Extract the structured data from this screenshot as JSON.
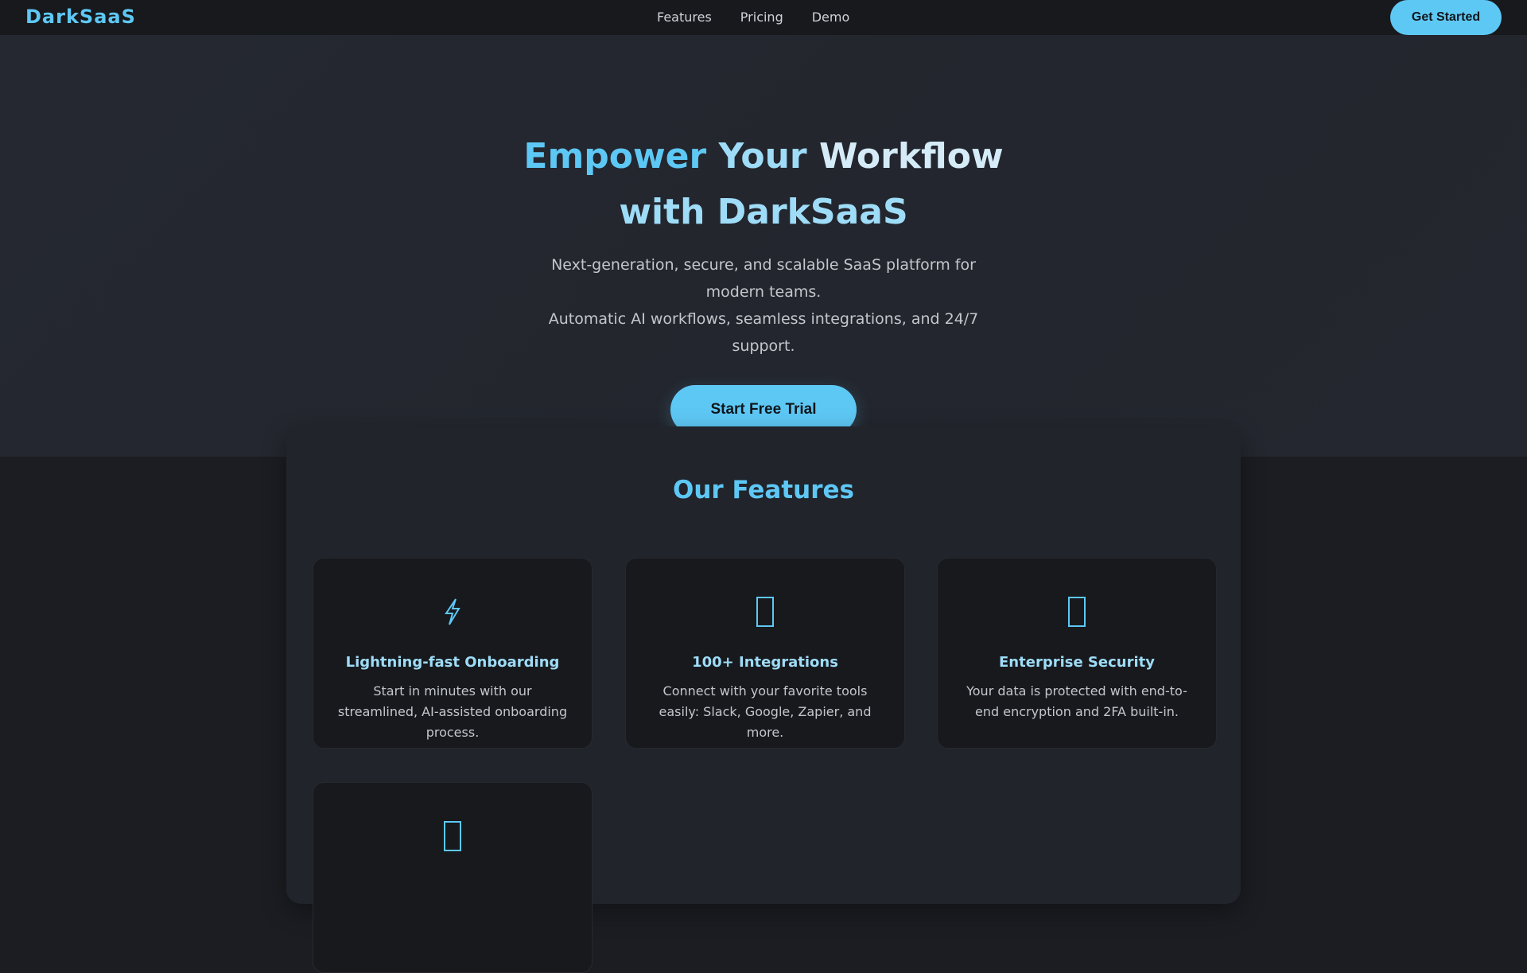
{
  "brand": {
    "logo": "DarkSaaS",
    "accent": "#5ec8f5"
  },
  "nav": {
    "items": [
      "Features",
      "Pricing",
      "Demo"
    ],
    "cta": "Get Started"
  },
  "hero": {
    "title_line1_word1": "Empower",
    "title_line1_word2": "Your",
    "title_line1_word3": "Workflow",
    "title_line2": "with DarkSaaS",
    "subtitle_line1": "Next-generation, secure, and scalable SaaS platform for modern teams.",
    "subtitle_line2": "Automatic AI workflows, seamless integrations, and 24/7 support.",
    "cta": "Start Free Trial"
  },
  "features": {
    "title": "Our Features",
    "cards": [
      {
        "icon": "lightning-icon",
        "title": "Lightning-fast Onboarding",
        "desc": "Start in minutes with our streamlined, AI-assisted onboarding process."
      },
      {
        "icon": "integrations-icon",
        "title": "100+ Integrations",
        "desc": "Connect with your favorite tools easily: Slack, Google, Zapier, and more."
      },
      {
        "icon": "security-icon",
        "title": "Enterprise Security",
        "desc": "Your data is protected with end-to-end encryption and 2FA built-in."
      },
      {
        "icon": "feature-icon",
        "title": "",
        "desc": ""
      }
    ]
  }
}
